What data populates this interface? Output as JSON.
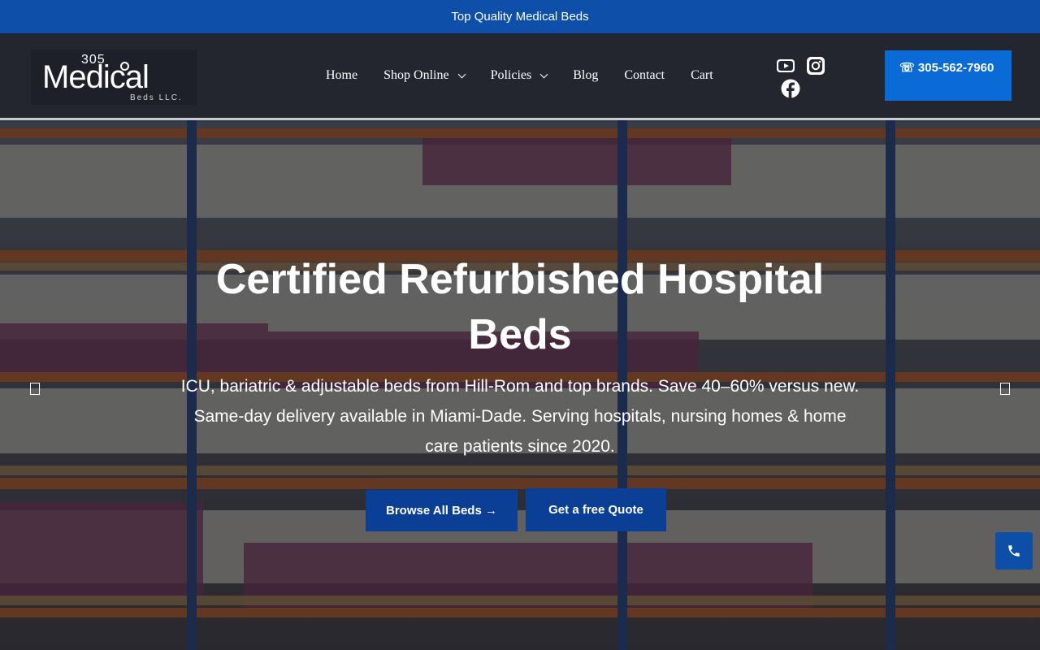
{
  "topbar": {
    "text": "Top Quality Medical Beds"
  },
  "logo": {
    "number": "305",
    "name": "Medical",
    "suffix": "Beds LLC."
  },
  "nav": {
    "items": [
      {
        "label": "Home"
      },
      {
        "label": "Shop Online"
      },
      {
        "label": "Policies"
      },
      {
        "label": "Blog"
      },
      {
        "label": "Contact"
      },
      {
        "label": "Cart"
      }
    ]
  },
  "social": [
    "youtube-icon",
    "instagram-icon",
    "facebook-icon"
  ],
  "phone": {
    "label": "☏ 305-562-7960"
  },
  "hero": {
    "title": "Certified Refurbished Hospital Beds",
    "text": "ICU, bariatric & adjustable beds from Hill-Rom and top brands. Save 40–60% versus new. Same-day delivery available in Miami-Dade. Serving hospitals, nursing homes & home care patients since 2020.",
    "browse_label": "Browse All Beds →",
    "quote_label": "Get a free Quote"
  },
  "colors": {
    "topbar": "#0d4fa9",
    "header": "#23262f",
    "phone_button": "#0b6bd6",
    "hero_buttons": "#0b3f96"
  }
}
